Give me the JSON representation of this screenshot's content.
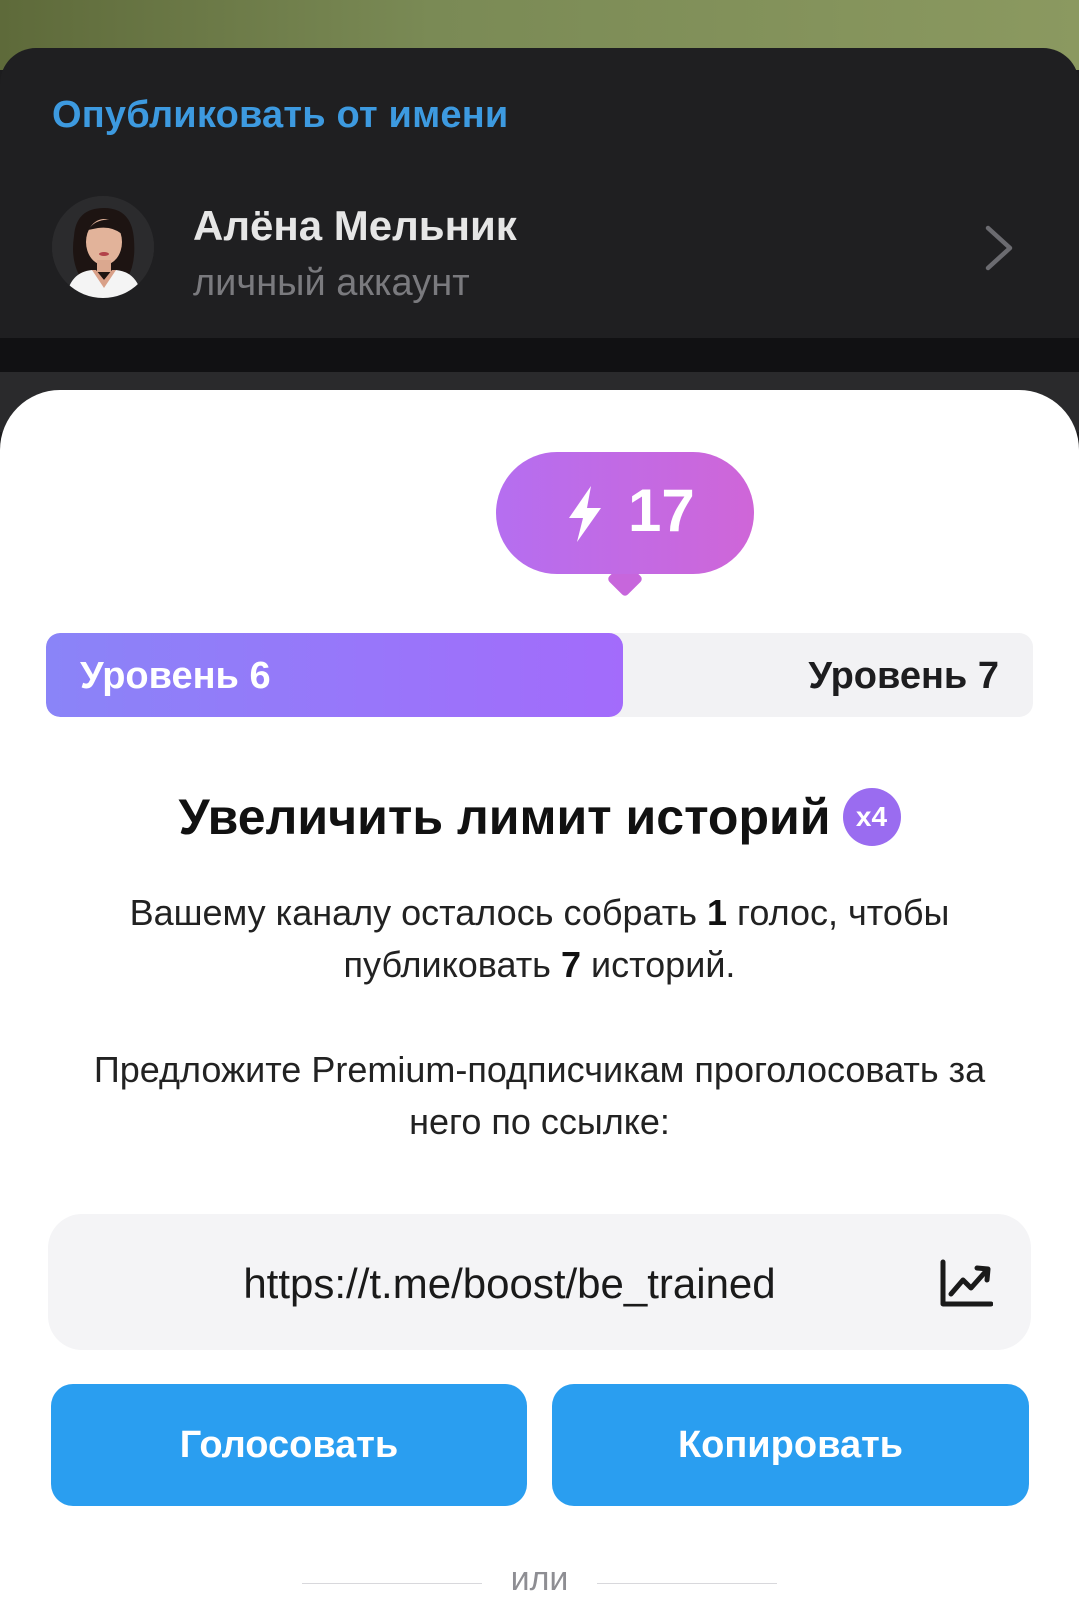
{
  "publish_as": {
    "heading": "Опубликовать от имени",
    "account": {
      "name": "Алёна Мельник",
      "subtitle": "личный аккаунт"
    }
  },
  "boost": {
    "count": "17",
    "icon": "lightning-bolt-icon",
    "level_progress": 0.585,
    "current_level_label": "Уровень 6",
    "next_level_label": "Уровень 7"
  },
  "feature": {
    "title": "Увеличить лимит историй",
    "badge": "x4",
    "description_parts": {
      "p1": "Вашему каналу осталось собрать ",
      "votes": "1",
      "p2": " голос, чтобы публиковать ",
      "stories": "7",
      "p3": " историй."
    },
    "invite_text": "Предложите Premium-подписчикам проголосовать за него по ссылке:"
  },
  "link": {
    "url": "https://t.me/boost/be_trained",
    "icon": "statistics-icon"
  },
  "actions": {
    "vote_label": "Голосовать",
    "copy_label": "Копировать"
  },
  "divider_label": "или",
  "colors": {
    "accent_blue": "#2a9ef0",
    "heading_blue": "#3d9ae0",
    "boost_purple": "#b56ef0",
    "level_fill": "#a36bfb"
  }
}
